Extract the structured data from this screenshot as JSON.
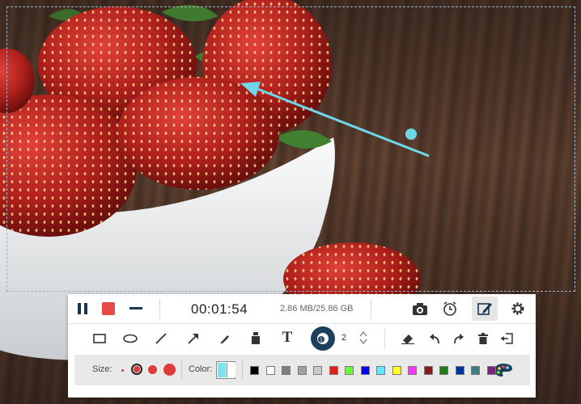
{
  "recording": {
    "elapsed_time": "00:01:54",
    "storage": "2.86 MB/25.86 GB"
  },
  "icons": {
    "pause": "pause-icon",
    "stop": "stop-icon",
    "minimize": "minimize-icon",
    "camera": "camera-icon",
    "clock": "clock-icon",
    "edit": "edit-icon",
    "settings": "gear-icon"
  },
  "draw_tools": [
    "rectangle",
    "ellipse",
    "line",
    "arrow",
    "pencil",
    "highlighter",
    "text",
    "number-callout",
    "eraser",
    "undo",
    "redo",
    "clear",
    "exit"
  ],
  "number_value": "2",
  "size_panel": {
    "label": "Size:",
    "sizes": [
      "tiny",
      "small",
      "medium",
      "large"
    ]
  },
  "color_panel": {
    "label": "Color:",
    "current_primary": "#7fe3ef",
    "current_secondary": "#ffffff",
    "palette": [
      "#000000",
      "#ffffff",
      "#7f7f7f",
      "#a0a0a0",
      "#c8c8c8",
      "#e02020",
      "#66ff33",
      "#0000ff",
      "#66e6ff",
      "#ffff33",
      "#ff33ff",
      "#8b1a1a",
      "#1f7a1f",
      "#003399",
      "#3a7f7f",
      "#7f1f7f"
    ]
  },
  "colors": {
    "annotation_arrow": "#6fd6e8",
    "stop_red": "#e84a4a",
    "number_badge": "#1d3f5c"
  }
}
